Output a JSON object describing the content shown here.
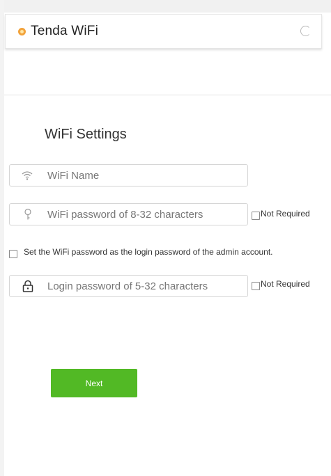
{
  "header": {
    "title": "Tenda WiFi",
    "logo_icon": "tenda-logo-icon",
    "refresh_icon": "refresh-icon"
  },
  "wifi_settings": {
    "title": "WiFi Settings",
    "wifi_name": {
      "placeholder": "WiFi Name",
      "value": "",
      "icon": "wifi-icon"
    },
    "wifi_password": {
      "placeholder": "WiFi password of 8-32 characters",
      "value": "",
      "icon": "key-icon"
    },
    "wifi_password_not_required": {
      "label": "Not Required",
      "checked": false
    },
    "same_as_admin": {
      "label": "Set the WiFi password as the login password of the admin account.",
      "checked": false
    },
    "login_password": {
      "placeholder": "Login password of 5-32 characters",
      "value": "",
      "icon": "lock-icon"
    },
    "login_password_not_required": {
      "label": "Not Required",
      "checked": false
    }
  },
  "actions": {
    "next_label": "Next"
  },
  "colors": {
    "accent": "#52b925",
    "logo": "#f2a23a"
  }
}
